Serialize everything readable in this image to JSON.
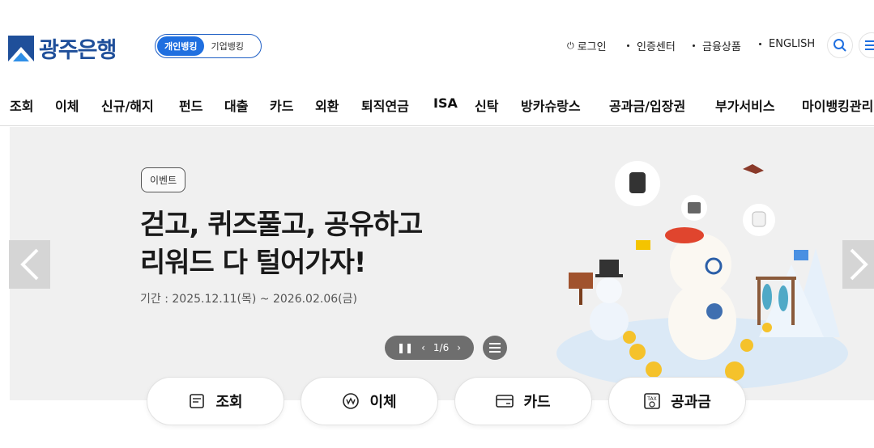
{
  "brand": {
    "name": "광주은행",
    "accent": "#1f6fe0",
    "navy": "#1f4f9a"
  },
  "segment": {
    "personal": "개인뱅킹",
    "corporate": "기업뱅킹"
  },
  "util": {
    "login": "로그인",
    "cert": "인증센터",
    "products": "금융상품",
    "english": "ENGLISH"
  },
  "gnb": [
    "조회",
    "이체",
    "신규/해지",
    "펀드",
    "대출",
    "카드",
    "외환",
    "퇴직연금",
    "ISA",
    "신탁",
    "방카슈랑스",
    "공과금/입장권",
    "부가서비스",
    "마이뱅킹관리"
  ],
  "hero": {
    "badge": "이벤트",
    "title_line1": "걷고, 퀴즈풀고, 공유하고",
    "title_line2": "리워드 다 털어가자!",
    "period": "기간 : 2025.12.11(목) ~ 2026.02.06(금)",
    "pager": "1/6"
  },
  "quick": [
    {
      "label": "조회",
      "icon": "inquiry-icon"
    },
    {
      "label": "이체",
      "icon": "transfer-icon"
    },
    {
      "label": "카드",
      "icon": "card-icon"
    },
    {
      "label": "공과금",
      "icon": "tax-icon"
    }
  ]
}
